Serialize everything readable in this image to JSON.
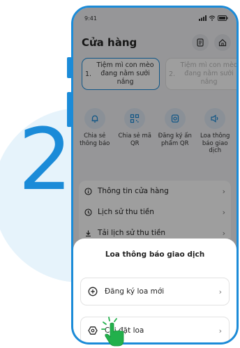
{
  "step_number": "2",
  "status": {
    "time": "9:41",
    "icons": [
      "signal-icon",
      "wifi-icon",
      "battery-icon"
    ]
  },
  "header": {
    "title": "Cửa hàng",
    "icons": [
      "receipt-icon",
      "home-icon"
    ]
  },
  "shops": [
    {
      "num": "1.",
      "name": "Tiệm mì con mèo đang nằm sưởi nắng",
      "active": true
    },
    {
      "num": "2.",
      "name": "Tiệm mì con mèo đang nằm sưởi nắng",
      "active": false
    }
  ],
  "actions": [
    {
      "label": "Chia sẻ thông báo",
      "icon": "bell-icon"
    },
    {
      "label": "Chia sẻ mã QR",
      "icon": "qr-icon"
    },
    {
      "label": "Đăng ký ấn phẩm QR",
      "icon": "qr-print-icon"
    },
    {
      "label": "Loa thông báo giao dịch",
      "icon": "speaker-icon"
    }
  ],
  "menu": [
    {
      "label": "Thông tin cửa hàng",
      "icon": "info-icon"
    },
    {
      "label": "Lịch sử thu tiền",
      "icon": "history-icon"
    },
    {
      "label": "Tải lịch sử thu tiền",
      "icon": "download-icon"
    }
  ],
  "sheet": {
    "title": "Loa thông báo giao dịch",
    "options": [
      {
        "label": "Đăng ký loa mới",
        "icon": "plus-circle-icon"
      },
      {
        "label": "Cài đặt loa",
        "icon": "hexagon-settings-icon"
      }
    ]
  },
  "colors": {
    "accent": "#1b8bd8",
    "overlay": "rgba(0,0,0,0.38)"
  }
}
